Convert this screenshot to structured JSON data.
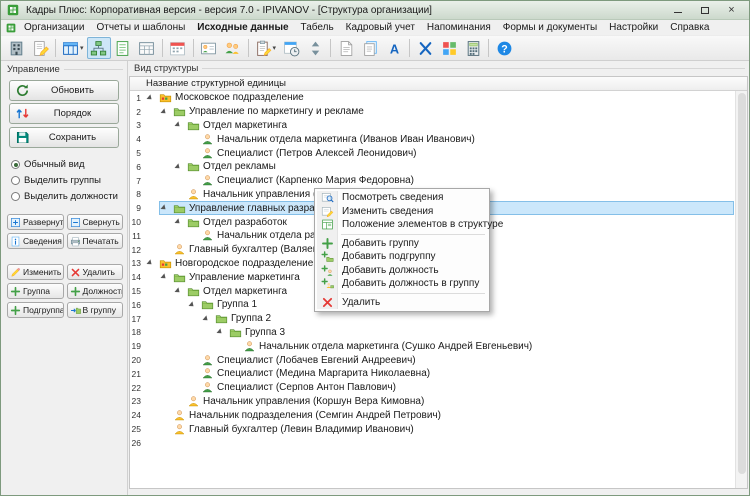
{
  "window": {
    "title": "Кадры Плюс: Корпоративная версия - версия 7.0 - IPIVANOV - [Структура организации]",
    "controls": [
      {
        "name": "minimize"
      },
      {
        "name": "maximize"
      },
      {
        "name": "close"
      }
    ]
  },
  "menubar": {
    "items": [
      {
        "label": "Организации"
      },
      {
        "label": "Отчеты и шаблоны"
      },
      {
        "label": "Исходные данные",
        "active": true
      },
      {
        "label": "Табель"
      },
      {
        "label": "Кадровый учет"
      },
      {
        "label": "Напоминания"
      },
      {
        "label": "Формы и документы"
      },
      {
        "label": "Настройки"
      },
      {
        "label": "Справка"
      }
    ]
  },
  "toolbar": {
    "buttons": [
      {
        "name": "organizations",
        "icon": "building"
      },
      {
        "name": "reports",
        "icon": "doc-pencil"
      },
      {
        "separator": true
      },
      {
        "name": "initial-data",
        "icon": "table-blue",
        "dropdown": true
      },
      {
        "name": "structure",
        "icon": "org-structure",
        "active": true
      },
      {
        "name": "staff-list",
        "icon": "doc-green"
      },
      {
        "name": "positions-table",
        "icon": "table-gray"
      },
      {
        "separator": true
      },
      {
        "name": "timesheet",
        "icon": "calendar"
      },
      {
        "separator": true
      },
      {
        "name": "employee-card",
        "icon": "person-card"
      },
      {
        "name": "personnel",
        "icon": "people"
      },
      {
        "separator": true
      },
      {
        "name": "orders",
        "icon": "clipboard-pencil",
        "dropdown": true
      },
      {
        "name": "reminders",
        "icon": "calendar-clock"
      },
      {
        "name": "sort-spin",
        "icon": "spin-arrows"
      },
      {
        "separator": true
      },
      {
        "name": "forms",
        "icon": "doc-plain"
      },
      {
        "name": "documents",
        "icon": "doc-stack"
      },
      {
        "name": "templates",
        "icon": "letter-a"
      },
      {
        "separator": true
      },
      {
        "name": "tools",
        "icon": "tools-x"
      },
      {
        "name": "settings",
        "icon": "grid-color"
      },
      {
        "name": "calculator",
        "icon": "calculator"
      },
      {
        "separator": true
      },
      {
        "name": "help",
        "icon": "help"
      }
    ]
  },
  "sidebar": {
    "title": "Управление",
    "big_buttons": [
      {
        "name": "refresh",
        "label": "Обновить",
        "icon": "refresh"
      },
      {
        "name": "order",
        "label": "Порядок",
        "icon": "order"
      },
      {
        "name": "save",
        "label": "Сохранить",
        "icon": "save"
      }
    ],
    "view_options": [
      {
        "name": "normal-view",
        "label": "Обычный вид",
        "checked": true
      },
      {
        "name": "highlight-groups",
        "label": "Выделить группы",
        "checked": false
      },
      {
        "name": "highlight-positions",
        "label": "Выделить должности",
        "checked": false
      }
    ],
    "small_buttons": [
      {
        "name": "expand",
        "label": "Развернуть",
        "icon": "expand"
      },
      {
        "name": "collapse",
        "label": "Свернуть",
        "icon": "collapse"
      },
      {
        "name": "details",
        "label": "Сведения",
        "icon": "info"
      },
      {
        "name": "print",
        "label": "Печатать",
        "icon": "print"
      },
      {
        "name": "edit",
        "label": "Изменить",
        "icon": "edit"
      },
      {
        "name": "delete",
        "label": "Удалить",
        "icon": "delete"
      },
      {
        "name": "group",
        "label": "Группа",
        "icon": "plus-green"
      },
      {
        "name": "position",
        "label": "Должность",
        "icon": "plus-green"
      },
      {
        "name": "subgroup",
        "label": "Подгруппа",
        "icon": "plus-green"
      },
      {
        "name": "to-group",
        "label": "В группу",
        "icon": "into-group"
      }
    ]
  },
  "main": {
    "panel_title": "Вид структуры",
    "column_header": "Название структурной единицы",
    "rows": [
      {
        "num": "1",
        "indent": 0,
        "icon": "org-unit",
        "expand": true,
        "label": "Московское подразделение"
      },
      {
        "num": "2",
        "indent": 1,
        "icon": "folder-green",
        "expand": true,
        "label": "Управление по маркетингу и рекламе"
      },
      {
        "num": "3",
        "indent": 2,
        "icon": "folder-green",
        "expand": true,
        "label": "Отдел маркетинга"
      },
      {
        "num": "4",
        "indent": 3,
        "icon": "person-green",
        "expand": false,
        "label": "Начальник отдела маркетинга (Иванов Иван Иванович)"
      },
      {
        "num": "5",
        "indent": 3,
        "icon": "person-green",
        "expand": false,
        "label": "Специалист (Петров Алексей Леонидович)"
      },
      {
        "num": "6",
        "indent": 2,
        "icon": "folder-green",
        "expand": true,
        "label": "Отдел рекламы"
      },
      {
        "num": "7",
        "indent": 3,
        "icon": "person-green",
        "expand": false,
        "label": "Специалист (Карпенко Мария Федоровна)"
      },
      {
        "num": "8",
        "indent": 2,
        "icon": "person-yellow",
        "expand": false,
        "label": "Начальник управления (Федосеева Антонина Алексеевна)"
      },
      {
        "num": "9",
        "indent": 1,
        "icon": "folder-green",
        "expand": true,
        "selected": true,
        "label": "Управление главных разработок"
      },
      {
        "num": "10",
        "indent": 2,
        "icon": "folder-green",
        "expand": true,
        "label": "Отдел разработок"
      },
      {
        "num": "11",
        "indent": 3,
        "icon": "person-green",
        "expand": false,
        "label": "Начальник отдела разработок (Юсупова Л"
      },
      {
        "num": "12",
        "indent": 1,
        "icon": "person-yellow",
        "expand": false,
        "label": "Главный бухгалтер (Валяев Геннадий И"
      },
      {
        "num": "13",
        "indent": 0,
        "icon": "org-unit",
        "expand": true,
        "label": "Новгородское подразделение"
      },
      {
        "num": "14",
        "indent": 1,
        "icon": "folder-green",
        "expand": true,
        "label": "Управление маркетинга"
      },
      {
        "num": "15",
        "indent": 2,
        "icon": "folder-green",
        "expand": true,
        "label": "Отдел маркетинга"
      },
      {
        "num": "16",
        "indent": 3,
        "icon": "folder-green",
        "expand": true,
        "label": "Группа 1"
      },
      {
        "num": "17",
        "indent": 4,
        "icon": "folder-green",
        "expand": true,
        "label": "Группа 2"
      },
      {
        "num": "18",
        "indent": 5,
        "icon": "folder-green",
        "expand": true,
        "label": "Группа 3"
      },
      {
        "num": "19",
        "indent": 6,
        "icon": "person-green",
        "expand": false,
        "label": "Начальник отдела маркетинга (Сушко Андрей Евгеньевич)"
      },
      {
        "num": "20",
        "indent": 3,
        "icon": "person-green",
        "expand": false,
        "label": "Специалист (Лобачев Евгений Андреевич)"
      },
      {
        "num": "21",
        "indent": 3,
        "icon": "person-green",
        "expand": false,
        "label": "Специалист (Медина Маргарита Николаевна)"
      },
      {
        "num": "22",
        "indent": 3,
        "icon": "person-green",
        "expand": false,
        "label": "Специалист (Серпов Антон Павлович)"
      },
      {
        "num": "23",
        "indent": 2,
        "icon": "person-yellow",
        "expand": false,
        "label": "Начальник управления (Коршун Вера Кимовна)"
      },
      {
        "num": "24",
        "indent": 1,
        "icon": "person-yellow",
        "expand": false,
        "label": "Начальник подразделения (Семгин Андрей Петрович)"
      },
      {
        "num": "25",
        "indent": 1,
        "icon": "person-yellow",
        "expand": false,
        "label": "Главный бухгалтер (Левин Владимир Иванович)"
      },
      {
        "num": "26",
        "indent": 0,
        "icon": "",
        "expand": false,
        "label": ""
      }
    ]
  },
  "context_menu": {
    "items": [
      {
        "name": "view-details",
        "label": "Посмотреть сведения",
        "icon": "magnifier-card"
      },
      {
        "name": "edit-details",
        "label": "Изменить сведения",
        "icon": "edit-card"
      },
      {
        "name": "element-position",
        "label": "Положение элементов в структуре",
        "icon": "position-card"
      },
      {
        "separator": true
      },
      {
        "name": "add-group",
        "label": "Добавить группу",
        "icon": "plus-green"
      },
      {
        "name": "add-subgroup",
        "label": "Добавить подгруппу",
        "icon": "plus-folder"
      },
      {
        "name": "add-position",
        "label": "Добавить должность",
        "icon": "plus-person"
      },
      {
        "name": "add-position-to-group",
        "label": "Добавить должность в группу",
        "icon": "plus-person-folder"
      },
      {
        "separator": true
      },
      {
        "name": "delete",
        "label": "Удалить",
        "icon": "delete"
      }
    ]
  }
}
